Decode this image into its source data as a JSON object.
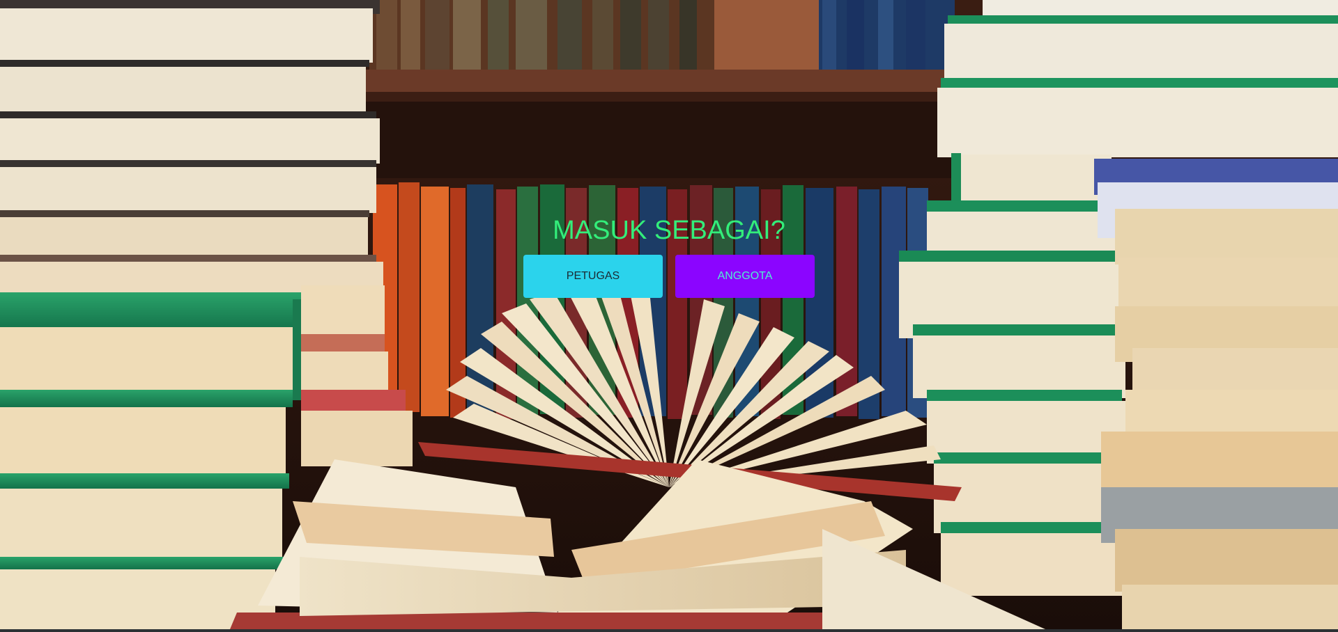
{
  "login": {
    "title": "MASUK SEBAGAI?",
    "buttons": [
      {
        "label": "PETUGAS",
        "background": "#2bd3ec",
        "text_color": "#1b2a33"
      },
      {
        "label": "ANGGOTA",
        "background": "#8b05ff",
        "text_color": "#4ff0d0"
      }
    ],
    "title_color": "#33ee7a"
  },
  "background": {
    "subject": "library-books-photo"
  }
}
